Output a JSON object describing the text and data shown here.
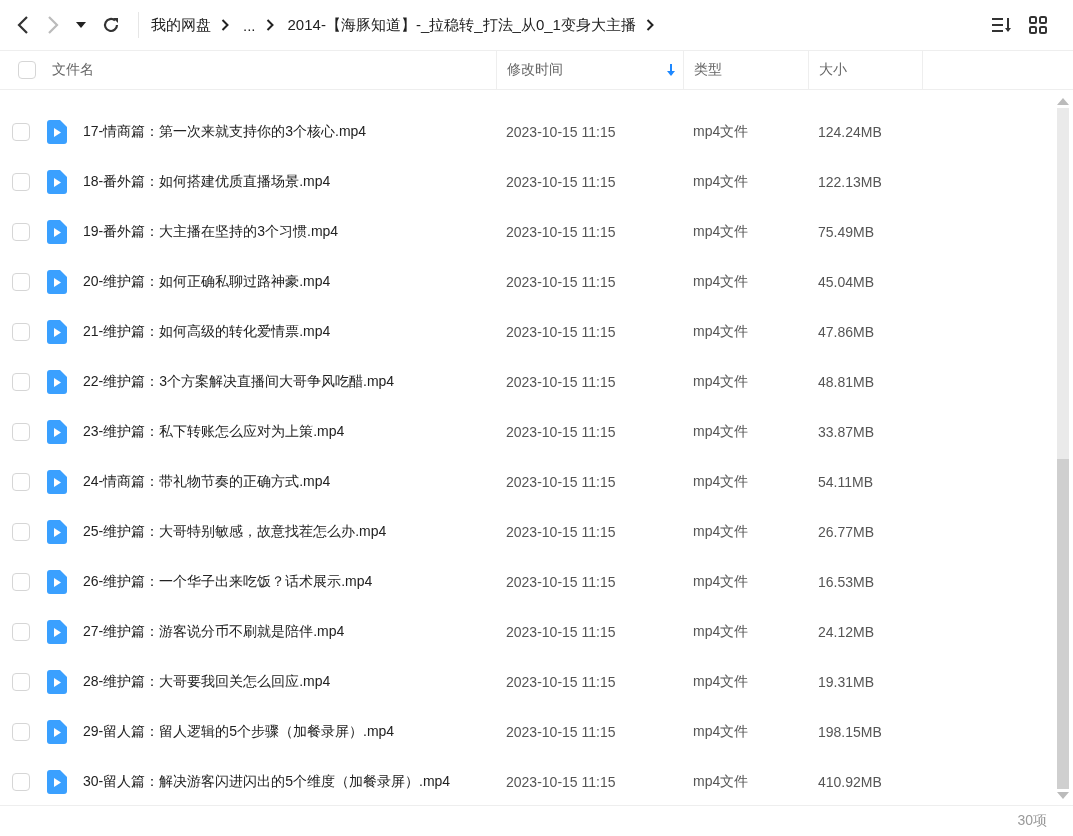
{
  "breadcrumb": [
    "我的网盘",
    "...",
    "2014-【海豚知道】-_拉稳转_打法_从0_1变身大主播"
  ],
  "columns": [
    {
      "label": "文件名",
      "sorted": false
    },
    {
      "label": "修改时间",
      "sorted": true
    },
    {
      "label": "类型",
      "sorted": false
    },
    {
      "label": "大小",
      "sorted": false
    }
  ],
  "header_checked": false,
  "rows": [
    {
      "name": "17-情商篇：第一次来就支持你的3个核心.mp4",
      "time": "2023-10-15 11:15",
      "type": "mp4文件",
      "size": "124.24MB",
      "checked": false
    },
    {
      "name": "18-番外篇：如何搭建优质直播场景.mp4",
      "time": "2023-10-15 11:15",
      "type": "mp4文件",
      "size": "122.13MB",
      "checked": false
    },
    {
      "name": "19-番外篇：大主播在坚持的3个习惯.mp4",
      "time": "2023-10-15 11:15",
      "type": "mp4文件",
      "size": "75.49MB",
      "checked": false
    },
    {
      "name": "20-维护篇：如何正确私聊过路神豪.mp4",
      "time": "2023-10-15 11:15",
      "type": "mp4文件",
      "size": "45.04MB",
      "checked": false
    },
    {
      "name": "21-维护篇：如何高级的转化爱情票.mp4",
      "time": "2023-10-15 11:15",
      "type": "mp4文件",
      "size": "47.86MB",
      "checked": false
    },
    {
      "name": "22-维护篇：3个方案解决直播间大哥争风吃醋.mp4",
      "time": "2023-10-15 11:15",
      "type": "mp4文件",
      "size": "48.81MB",
      "checked": false
    },
    {
      "name": "23-维护篇：私下转账怎么应对为上策.mp4",
      "time": "2023-10-15 11:15",
      "type": "mp4文件",
      "size": "33.87MB",
      "checked": false
    },
    {
      "name": "24-情商篇：带礼物节奏的正确方式.mp4",
      "time": "2023-10-15 11:15",
      "type": "mp4文件",
      "size": "54.11MB",
      "checked": false
    },
    {
      "name": "25-维护篇：大哥特别敏感，故意找茬怎么办.mp4",
      "time": "2023-10-15 11:15",
      "type": "mp4文件",
      "size": "26.77MB",
      "checked": false
    },
    {
      "name": "26-维护篇：一个华子出来吃饭？话术展示.mp4",
      "time": "2023-10-15 11:15",
      "type": "mp4文件",
      "size": "16.53MB",
      "checked": false
    },
    {
      "name": "27-维护篇：游客说分币不刷就是陪伴.mp4",
      "time": "2023-10-15 11:15",
      "type": "mp4文件",
      "size": "24.12MB",
      "checked": false
    },
    {
      "name": "28-维护篇：大哥要我回关怎么回应.mp4",
      "time": "2023-10-15 11:15",
      "type": "mp4文件",
      "size": "19.31MB",
      "checked": false
    },
    {
      "name": "29-留人篇：留人逻辑的5个步骤（加餐录屏）.mp4",
      "time": "2023-10-15 11:15",
      "type": "mp4文件",
      "size": "198.15MB",
      "checked": false
    },
    {
      "name": "30-留人篇：解决游客闪进闪出的5个维度（加餐录屏）.mp4",
      "time": "2023-10-15 11:15",
      "type": "mp4文件",
      "size": "410.92MB",
      "checked": false
    }
  ],
  "status_bar": {
    "count": "30项"
  }
}
